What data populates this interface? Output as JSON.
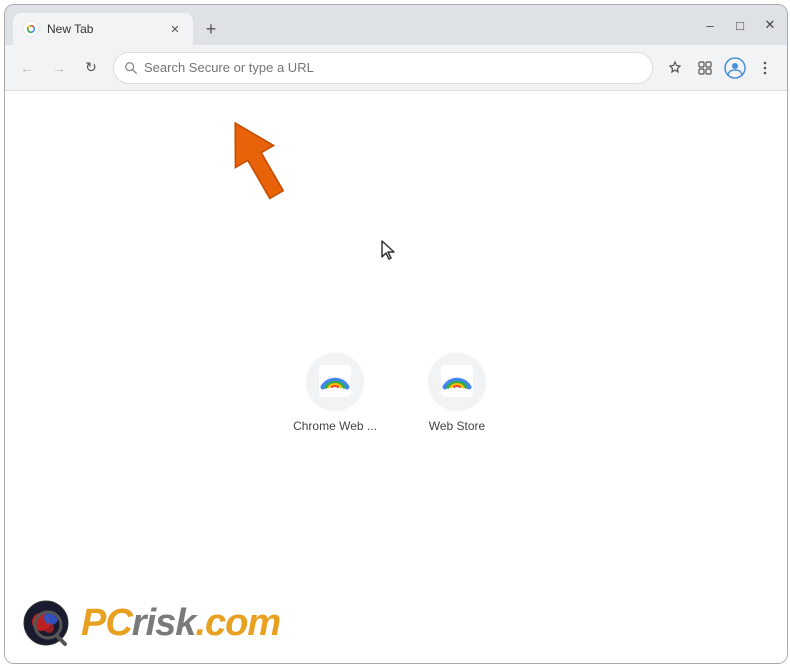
{
  "window": {
    "title": "New Tab",
    "tab_label": "New Tab"
  },
  "controls": {
    "minimize": "–",
    "maximize": "□",
    "close": "✕",
    "new_tab": "+",
    "back": "←",
    "forward": "→",
    "refresh": "↻"
  },
  "addressbar": {
    "placeholder": "Search Secure or type a URL",
    "value": ""
  },
  "shortcuts": [
    {
      "label": "Chrome Web ...",
      "type": "webstore"
    },
    {
      "label": "Web Store",
      "type": "webstore2"
    }
  ],
  "watermark": {
    "brand": "PC",
    "brand_suffix": "risk.com"
  }
}
